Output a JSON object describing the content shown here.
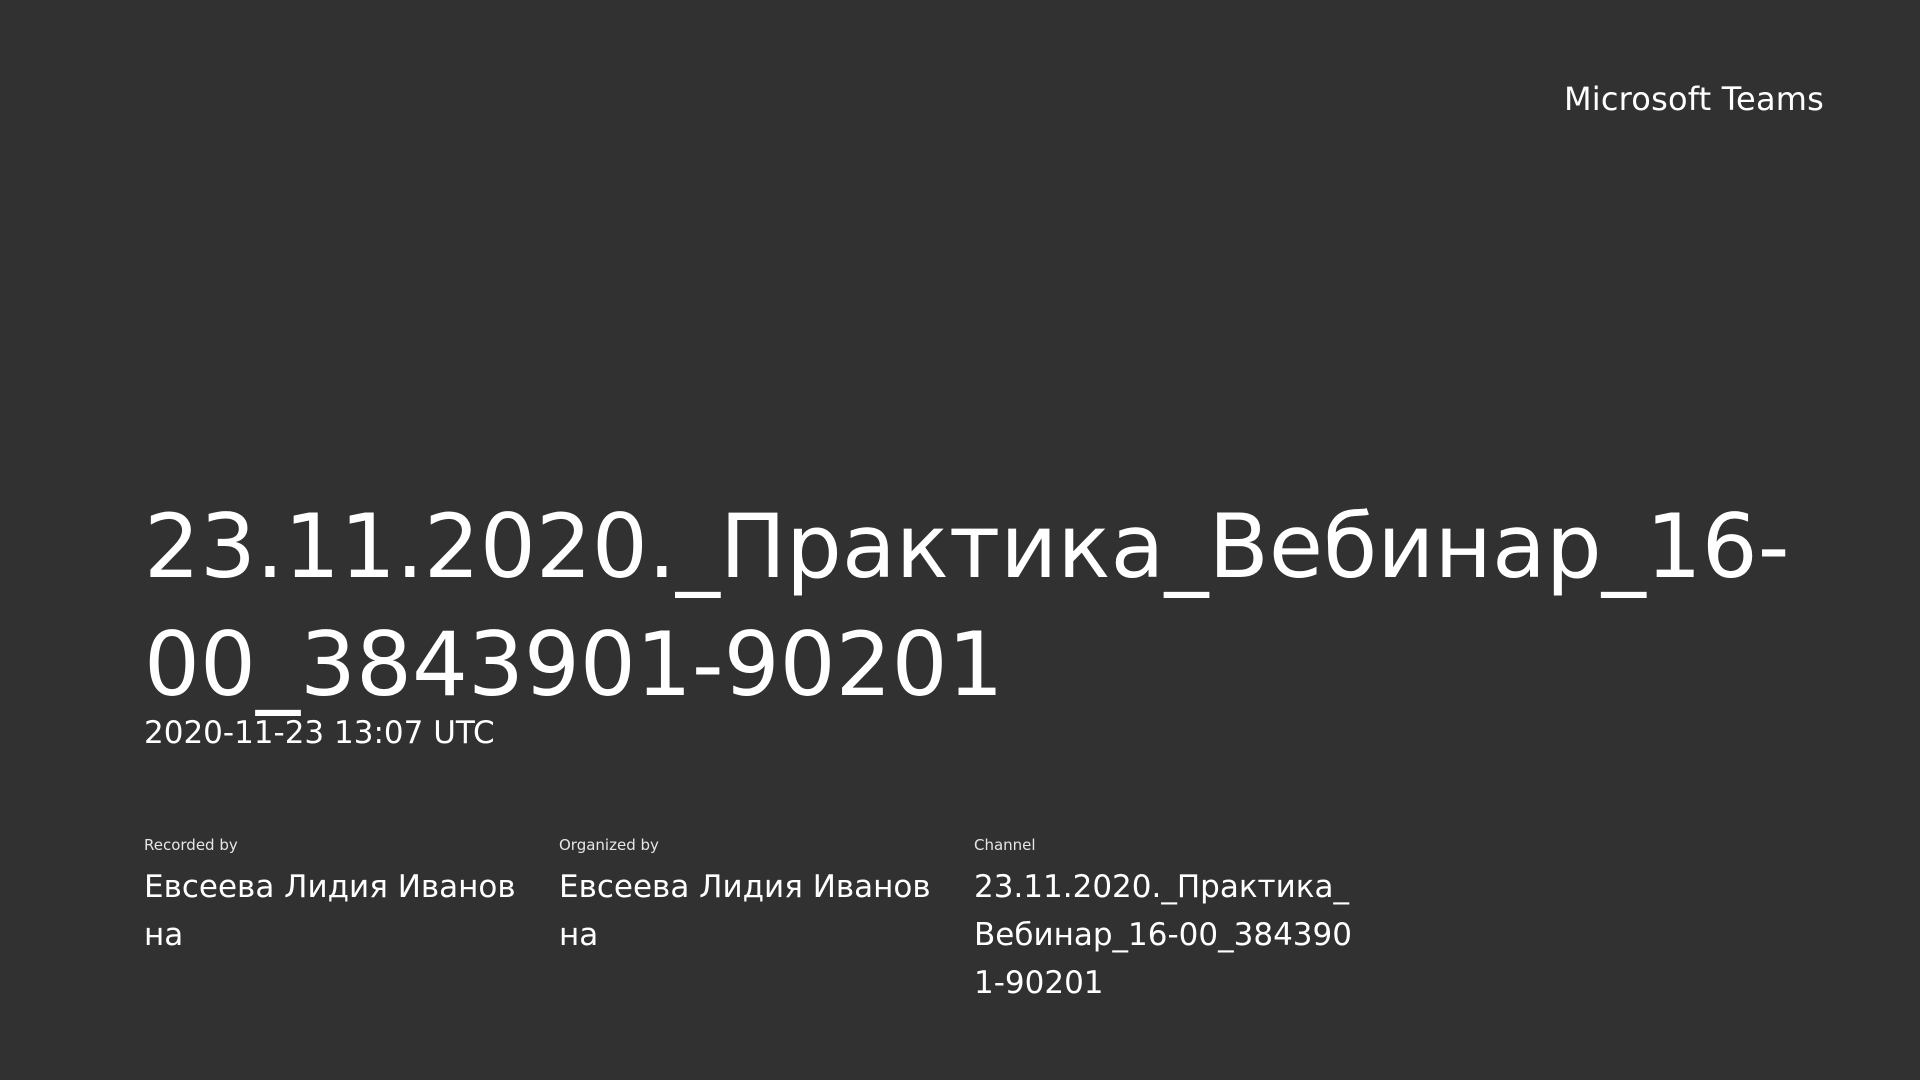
{
  "brand": "Microsoft Teams",
  "title": "23.11.2020._Практика_Вебинар_16-00_3843901-90201",
  "timestamp": "2020-11-23 13:07 UTC",
  "meta": {
    "recorded_by": {
      "label": "Recorded by",
      "value": "Евсеева Лидия Ивановна"
    },
    "organized_by": {
      "label": "Organized by",
      "value": "Евсеева Лидия Ивановна"
    },
    "channel": {
      "label": "Channel",
      "value": "23.11.2020._Практика_Вебинар_16-00_3843901-90201"
    }
  }
}
